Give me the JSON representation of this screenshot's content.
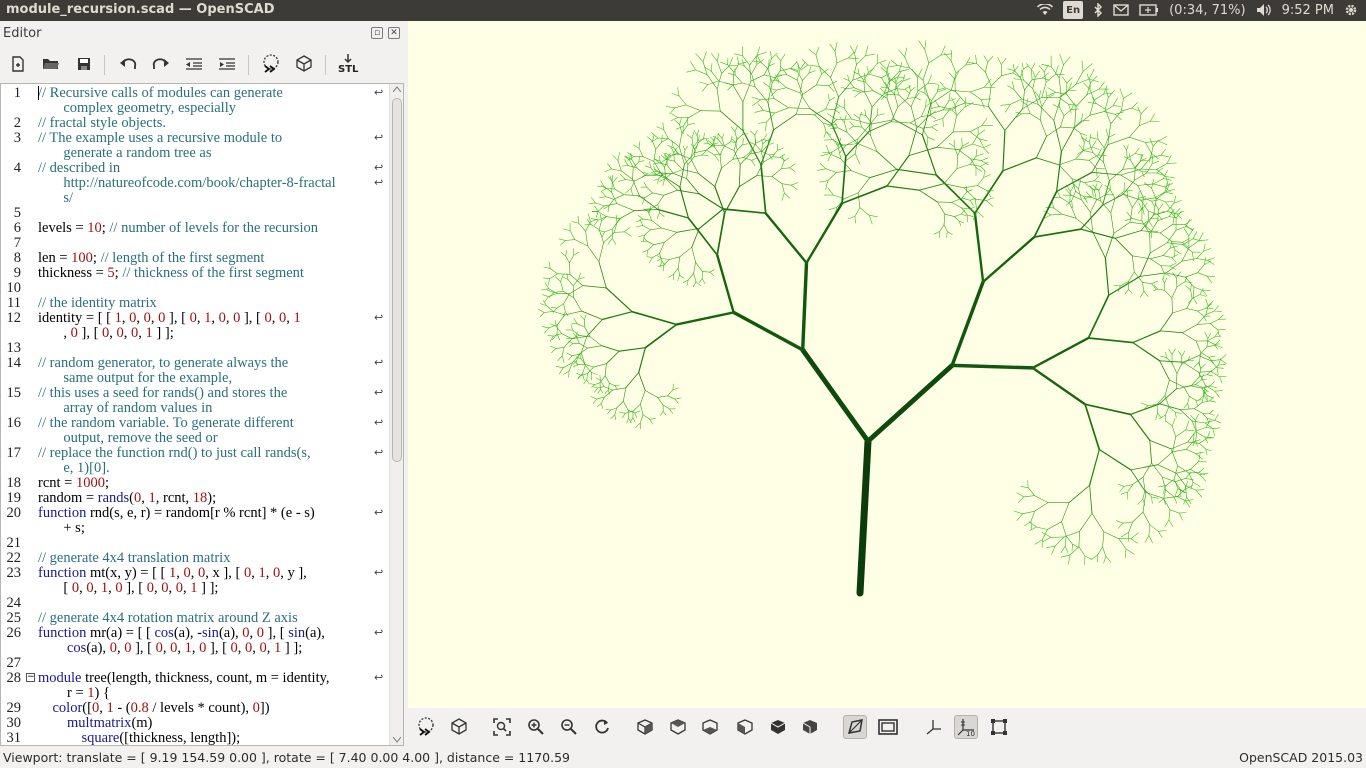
{
  "window": {
    "title": "module_recursion.scad — OpenSCAD"
  },
  "tray": {
    "lang": "En",
    "battery": "(0:34, 71%)",
    "time": "9:52 PM"
  },
  "editor": {
    "title": "Editor",
    "toolbar": [
      "new-file",
      "open-file",
      "save-file",
      "undo",
      "redo",
      "unindent",
      "indent",
      "preview",
      "render",
      "export-stl"
    ],
    "stl_label": "STL"
  },
  "code": {
    "lines": [
      {
        "n": "1",
        "rows": [
          "// Recursive calls of modules can generate",
          "       complex geometry, especially"
        ]
      },
      {
        "n": "2",
        "rows": [
          "// fractal style objects."
        ]
      },
      {
        "n": "3",
        "rows": [
          "// The example uses a recursive module to",
          "       generate a random tree as"
        ]
      },
      {
        "n": "4",
        "rows": [
          "// described in",
          "       http://natureofcode.com/book/chapter-8-fractal",
          "       s/"
        ]
      },
      {
        "n": "5",
        "rows": [
          ""
        ]
      },
      {
        "n": "6",
        "rows": [
          "levels = 10; // number of levels for the recursion"
        ]
      },
      {
        "n": "7",
        "rows": [
          ""
        ]
      },
      {
        "n": "8",
        "rows": [
          "len = 100; // length of the first segment"
        ]
      },
      {
        "n": "9",
        "rows": [
          "thickness = 5; // thickness of the first segment"
        ]
      },
      {
        "n": "10",
        "rows": [
          ""
        ]
      },
      {
        "n": "11",
        "rows": [
          "// the identity matrix"
        ]
      },
      {
        "n": "12",
        "rows": [
          "identity = [ [ 1, 0, 0, 0 ], [ 0, 1, 0, 0 ], [ 0, 0, 1",
          "       , 0 ], [ 0, 0, 0, 1 ] ];"
        ]
      },
      {
        "n": "13",
        "rows": [
          ""
        ]
      },
      {
        "n": "14",
        "rows": [
          "// random generator, to generate always the",
          "       same output for the example,"
        ]
      },
      {
        "n": "15",
        "rows": [
          "// this uses a seed for rands() and stores the",
          "       array of random values in"
        ]
      },
      {
        "n": "16",
        "rows": [
          "// the random variable. To generate different",
          "       output, remove the seed or"
        ]
      },
      {
        "n": "17",
        "rows": [
          "// replace the function rnd() to just call rands(s,",
          "       e, 1)[0]."
        ]
      },
      {
        "n": "18",
        "rows": [
          "rcnt = 1000;"
        ]
      },
      {
        "n": "19",
        "rows": [
          "random = rands(0, 1, rcnt, 18);"
        ]
      },
      {
        "n": "20",
        "rows": [
          "function rnd(s, e, r) = random[r % rcnt] * (e - s)",
          "       + s;"
        ]
      },
      {
        "n": "21",
        "rows": [
          ""
        ]
      },
      {
        "n": "22",
        "rows": [
          "// generate 4x4 translation matrix"
        ]
      },
      {
        "n": "23",
        "rows": [
          "function mt(x, y) = [ [ 1, 0, 0, x ], [ 0, 1, 0, y ],",
          "       [ 0, 0, 1, 0 ], [ 0, 0, 0, 1 ] ];"
        ]
      },
      {
        "n": "24",
        "rows": [
          ""
        ]
      },
      {
        "n": "25",
        "rows": [
          "// generate 4x4 rotation matrix around Z axis"
        ]
      },
      {
        "n": "26",
        "rows": [
          "function mr(a) = [ [ cos(a), -sin(a), 0, 0 ], [ sin(a),",
          "        cos(a), 0, 0 ], [ 0, 0, 1, 0 ], [ 0, 0, 0, 1 ] ];"
        ]
      },
      {
        "n": "27",
        "rows": [
          ""
        ]
      },
      {
        "n": "28",
        "rows": [
          "module tree(length, thickness, count, m = identity,",
          "        r = 1) {"
        ]
      },
      {
        "n": "29",
        "rows": [
          "    color([0, 1 - (0.8 / levels * count), 0])"
        ]
      },
      {
        "n": "30",
        "rows": [
          "        multmatrix(m)"
        ]
      },
      {
        "n": "31",
        "rows": [
          "            square([thickness, length]);"
        ]
      }
    ]
  },
  "viewport": {
    "background": "#ffffe5",
    "trunk_color": "#0a3d0a",
    "leaf_color": "#2aa81c"
  },
  "vtoolbar": [
    "preview",
    "render",
    "view-all",
    "zoom-in",
    "zoom-out",
    "reset-view",
    "view-right",
    "view-top",
    "view-bottom",
    "view-left",
    "view-front",
    "view-back",
    "perspective",
    "orthogonal",
    "show-axes",
    "show-scale-markers",
    "show-edges"
  ],
  "status": {
    "left": "Viewport: translate = [ 9.19 154.59 0.00 ], rotate = [ 7.40 0.00 4.00 ], distance = 1170.59",
    "right": "OpenSCAD 2015.03"
  }
}
